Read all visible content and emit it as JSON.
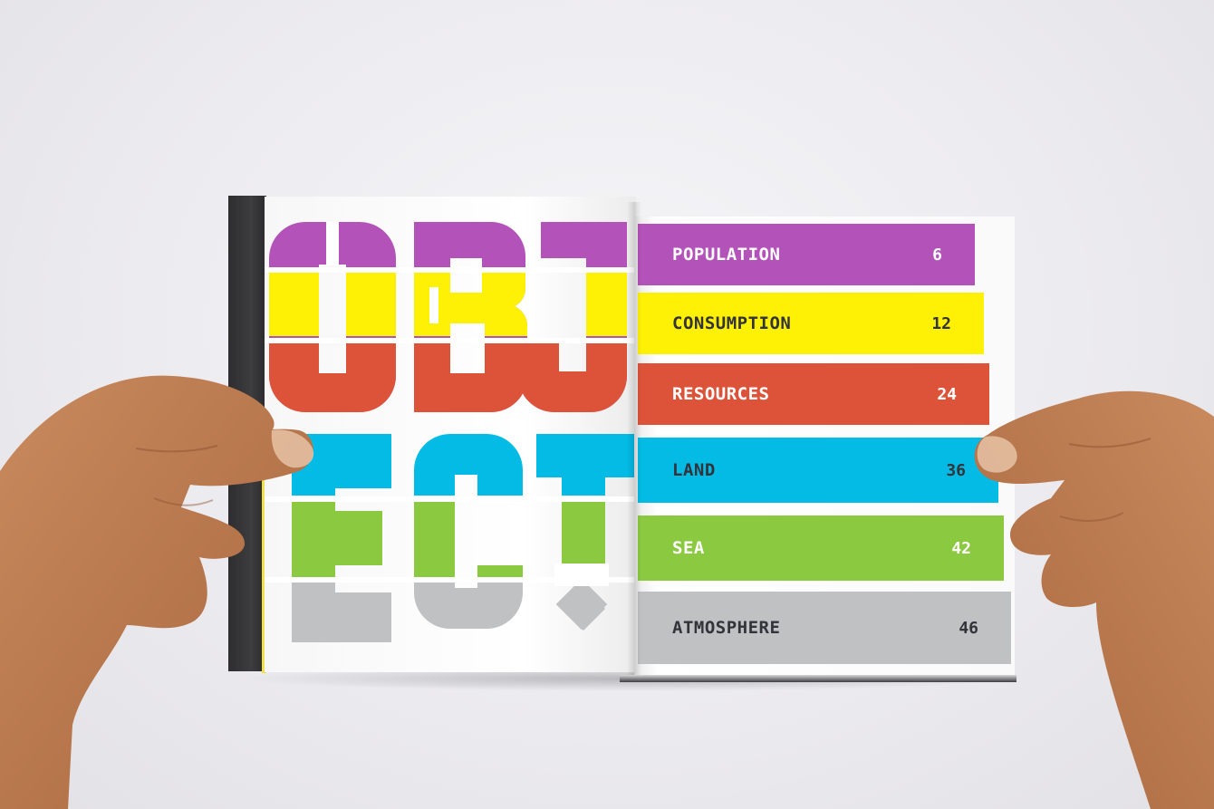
{
  "book": {
    "left_page": {
      "title_letters": [
        "O",
        "B",
        "J",
        "E",
        "C",
        "T",
        "!"
      ]
    },
    "contents": [
      {
        "label": "POPULATION",
        "page": "6",
        "color": "#b352b8",
        "text_color": "#ffffff"
      },
      {
        "label": "CONSUMPTION",
        "page": "12",
        "color": "#fef106",
        "text_color": "#33333a"
      },
      {
        "label": "RESOURCES",
        "page": "24",
        "color": "#dc533a",
        "text_color": "#ffffff"
      },
      {
        "label": "LAND",
        "page": "36",
        "color": "#03bbe5",
        "text_color": "#33333a"
      },
      {
        "label": "SEA",
        "page": "42",
        "color": "#8ac940",
        "text_color": "#ffffff"
      },
      {
        "label": "ATMOSPHERE",
        "page": "46",
        "color": "#bfc1c2",
        "text_color": "#33333a"
      }
    ],
    "colors": {
      "purple": "#b352b8",
      "yellow": "#fef106",
      "red": "#dc533a",
      "cyan": "#03bbe5",
      "green": "#8ac940",
      "grey": "#bfc1c2"
    }
  }
}
